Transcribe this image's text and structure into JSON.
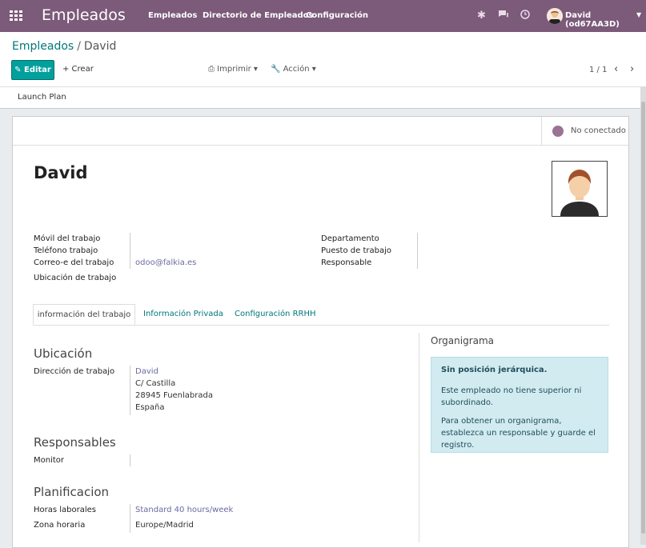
{
  "topbar": {
    "app_title": "Empleados",
    "menu": [
      "Empleados",
      "Directorio de Empleados",
      "Configuración"
    ],
    "user_name": "David (od67AA3D)"
  },
  "control_panel": {
    "breadcrumb_parent": "Empleados",
    "breadcrumb_sep": "/",
    "breadcrumb_current": "David",
    "edit_label": "✎ Editar",
    "create_label": "+ Crear",
    "print_label": "⎙ Imprimir ▾",
    "action_label": "🔧 Acción ▾",
    "pager": "1 / 1"
  },
  "statusbar": {
    "launch_plan": "Launch Plan"
  },
  "presence": {
    "label": "No conectado",
    "color": "#9b7395"
  },
  "employee": {
    "name": "David",
    "left_fields": [
      {
        "label": "Móvil del trabajo",
        "value": ""
      },
      {
        "label": "Teléfono trabajo",
        "value": ""
      },
      {
        "label": "Correo-e del trabajo",
        "value": "odoo@falkia.es"
      },
      {
        "label": "Ubicación de trabajo",
        "value": ""
      }
    ],
    "right_fields": [
      {
        "label": "Departamento",
        "value": ""
      },
      {
        "label": "Puesto de trabajo",
        "value": ""
      },
      {
        "label": "Responsable",
        "value": ""
      }
    ]
  },
  "tabs": [
    "información del trabajo",
    "Información Privada",
    "Configuración RRHH"
  ],
  "sections": {
    "ubicacion": {
      "title": "Ubicación",
      "address_label": "Dirección de trabajo",
      "address_lines": [
        "David",
        "C/ Castilla",
        "28945 Fuenlabrada",
        "España"
      ]
    },
    "responsables": {
      "title": "Responsables",
      "monitor_label": "Monitor",
      "monitor_value": ""
    },
    "planificacion": {
      "title": "Planificacion",
      "hours_label": "Horas laborales",
      "hours_value": "Standard 40 hours/week",
      "tz_label": "Zona horaria",
      "tz_value": "Europe/Madrid"
    }
  },
  "organigram": {
    "title": "Organigrama",
    "alert_title": "Sin posición jerárquica.",
    "alert_p1": "Este empleado no tiene superior ni subordinado.",
    "alert_p2": "Para obtener un organigrama, establezca un responsable y guarde el registro."
  },
  "colors": {
    "topbar": "#7c5a7a",
    "primary": "#00a09d",
    "link": "#00787a"
  }
}
